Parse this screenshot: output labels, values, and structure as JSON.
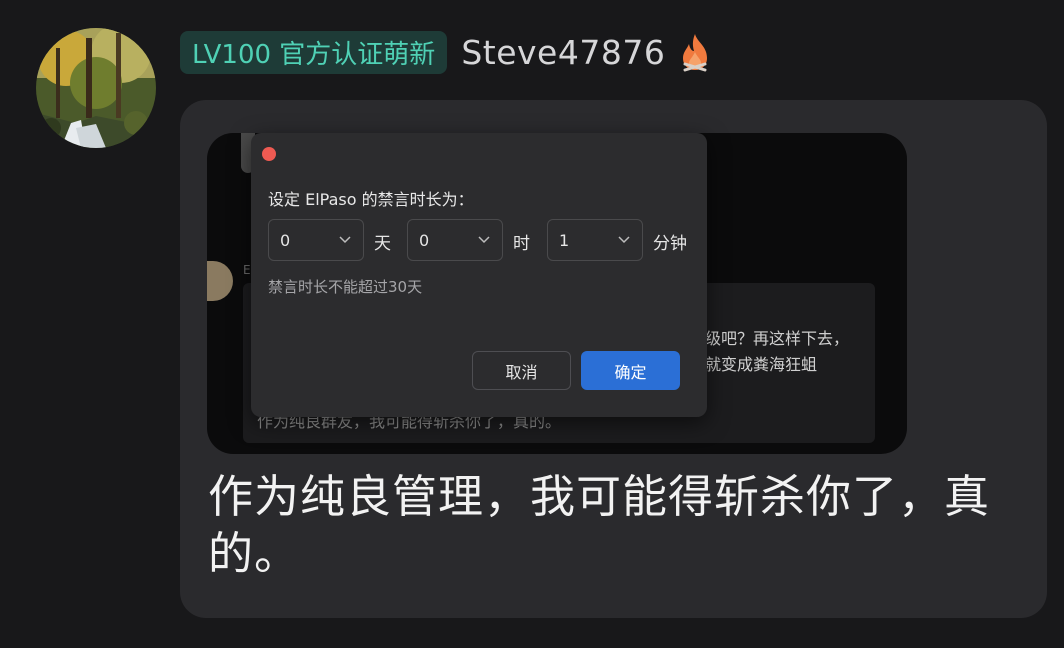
{
  "user": {
    "level_badge": "LV100 官方认证萌新",
    "username": "Steve47876",
    "avatar_icon": "forest-waterfall-avatar",
    "badge_icon": "fire-icon"
  },
  "screenshot": {
    "background_text": {
      "line1": "级吧？再这样下去，",
      "line2": "就变成粪海狂蛆",
      "line3": "作为纯良群友，我可能得斩杀你了，真的。"
    },
    "dialog": {
      "title": "设定  ElPaso  的禁言时长为：",
      "days_value": "0",
      "days_unit": "天",
      "hours_value": "0",
      "hours_unit": "时",
      "minutes_value": "1",
      "minutes_unit": "分钟",
      "hint": "禁言时长不能超过30天",
      "cancel_label": "取消",
      "confirm_label": "确定",
      "colors": {
        "confirm": "#2b6fd6",
        "close_dot": "#ee5a52"
      }
    }
  },
  "message": {
    "text": "作为纯良管理，我可能得斩杀你了，真的。"
  },
  "colors": {
    "badge_text": "#4fd1b5",
    "badge_bg": "#1e3b37",
    "background": "#18181a",
    "bubble": "#2a2a2d"
  }
}
